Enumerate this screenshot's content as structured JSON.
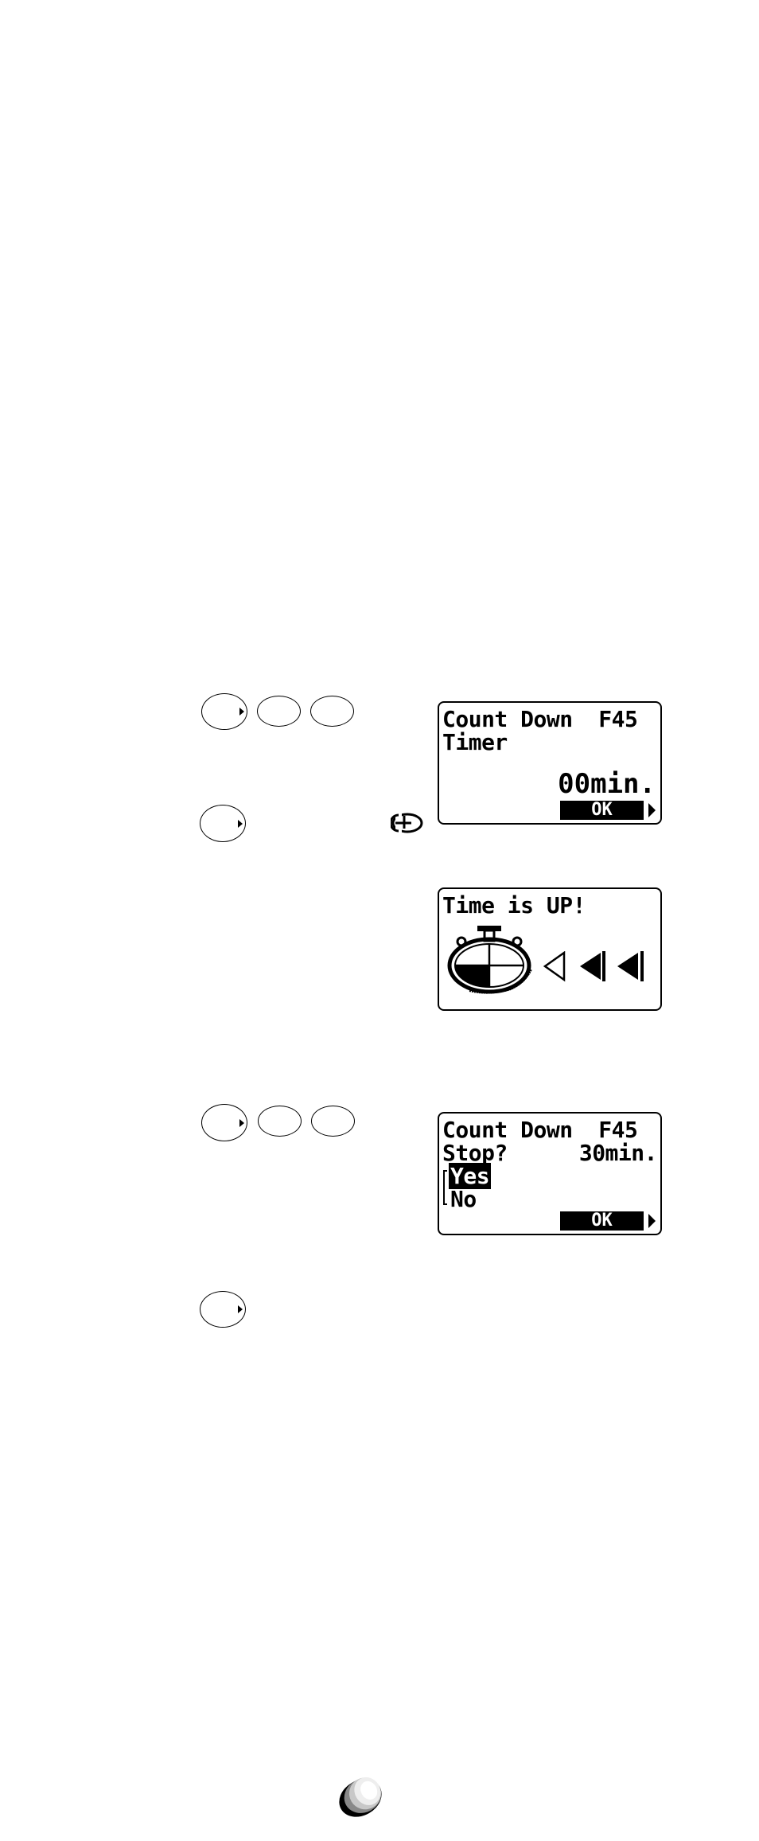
{
  "steps": [
    {
      "keys": [
        {
          "icon": "key-with-arrow"
        },
        {
          "icon": "key"
        },
        {
          "icon": "key"
        }
      ]
    },
    {
      "keys": [
        {
          "icon": "key-with-arrow"
        }
      ],
      "status_icon": "timer-icon"
    },
    {
      "keys": [
        {
          "icon": "key-with-arrow"
        },
        {
          "icon": "key"
        },
        {
          "icon": "key"
        }
      ]
    },
    {
      "keys": [
        {
          "icon": "key-with-arrow"
        }
      ]
    }
  ],
  "screens": {
    "timer": {
      "title": "Count Down",
      "code": "F45",
      "line2": "Timer",
      "value": "00min.",
      "ok_label": "OK"
    },
    "time_up": {
      "message": "Time is UP!",
      "icon": "stopwatch-icon",
      "alarm_icon": "alarm-arrows-icon"
    },
    "stop": {
      "title": "Count Down",
      "code": "F45",
      "question": "Stop?",
      "value": "30min.",
      "options": [
        "Yes",
        "No"
      ],
      "selected": "Yes",
      "ok_label": "OK"
    }
  },
  "footer": {
    "logo_icon": "sphere-logo-icon"
  }
}
